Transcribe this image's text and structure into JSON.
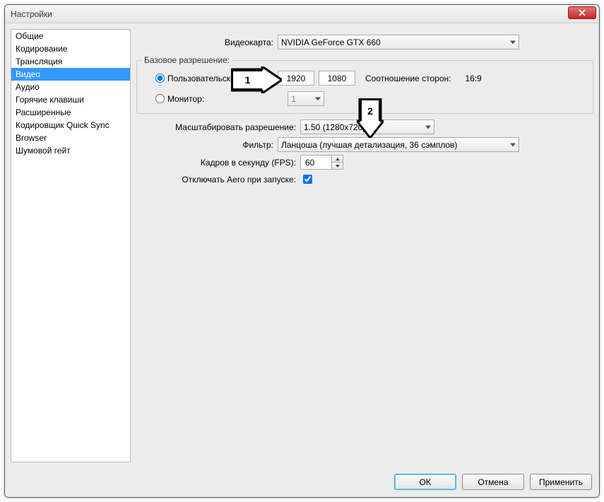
{
  "window": {
    "title": "Настройки"
  },
  "sidebar": {
    "items": [
      {
        "label": "Общие"
      },
      {
        "label": "Кодирование"
      },
      {
        "label": "Трансляция"
      },
      {
        "label": "Видео",
        "selected": true
      },
      {
        "label": "Аудио"
      },
      {
        "label": "Горячие клавиши"
      },
      {
        "label": "Расширенные"
      },
      {
        "label": "Кодировщик Quick Sync"
      },
      {
        "label": "Browser"
      },
      {
        "label": "Шумовой гейт"
      }
    ]
  },
  "video": {
    "gpu_label": "Видеокарта:",
    "gpu_value": "NVIDIA GeForce GTX 660",
    "base_res_group": "Базовое разрешение:",
    "radio_custom": "Пользовательское:",
    "radio_monitor": "Монитор:",
    "width": "1920",
    "height": "1080",
    "aspect_label": "Соотношение сторон:",
    "aspect_value": "16:9",
    "monitor_value": "1",
    "scale_label": "Масштабировать разрешение:",
    "scale_value": "1.50  (1280x720)",
    "filter_label": "Фильтр:",
    "filter_value": "Ланцоша (лучшая детализация, 36 сэмплов)",
    "fps_label": "Кадров в секунду (FPS):",
    "fps_value": "60",
    "aero_label": "Отключать Aero при запуске:",
    "aero_checked": true
  },
  "annotations": {
    "callout1": "1",
    "callout2": "2"
  },
  "buttons": {
    "ok": "OK",
    "cancel": "Отмена",
    "apply": "Применить"
  }
}
